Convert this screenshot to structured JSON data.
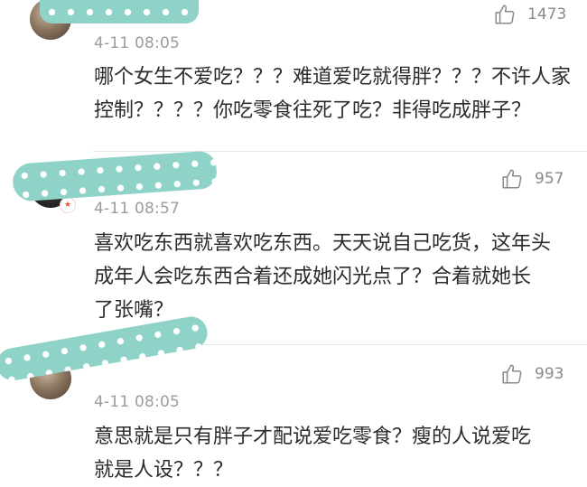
{
  "comments": [
    {
      "time": "4-11 08:05",
      "likes": "1473",
      "text": "哪个女生不爱吃？？？难道爱吃就得胖？？？不许人家\n控制？？？？你吃零食往死了吃？非得吃成胖子？"
    },
    {
      "time": "4-11 08:57",
      "likes": "957",
      "badge_icon": "★",
      "text": "喜欢吃东西就喜欢吃东西。天天说自己吃货，这年头\n成年人会吃东西合着还成她闪光点了？合着就她长\n了张嘴？"
    },
    {
      "time": "4-11 08:05",
      "likes": "993",
      "text": "意思就是只有胖子才配说爱吃零食？瘦的人说爱吃\n就是人设？？？"
    }
  ],
  "icons": {
    "like": "thumbs-up-icon"
  },
  "colors": {
    "redaction": "#8fd3c8",
    "time": "#9c9c9c",
    "text": "#2b2b2b",
    "likes": "#8a8a8a"
  }
}
